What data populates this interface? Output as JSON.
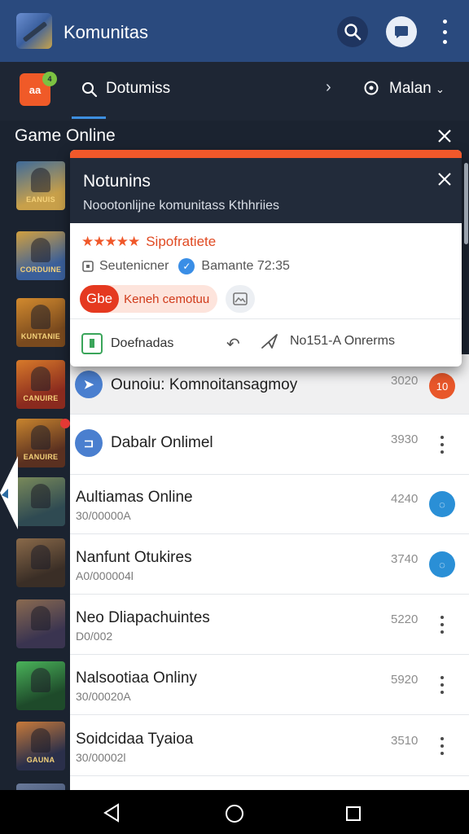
{
  "app_bar": {
    "title": "Komunitas",
    "color": "#2a4a7e"
  },
  "sub_bar": {
    "search_label": "Dotumiss",
    "right_label": "Malan",
    "icon_label": "aa",
    "badge": "4"
  },
  "section": {
    "title": "Game Online"
  },
  "popup": {
    "title": "Notunins",
    "subtitle": "Noootonlijne komunitass Kthhriies",
    "rating_label": "Sipofratiete",
    "stars": "★★★★★",
    "meta_user": "Seutenicner",
    "meta_time": "Bamante 72:35",
    "chip_badge": "Gbe",
    "chip_label": "Keneh cemotuu",
    "footer_left": "Doefnadas",
    "footer_right": "No151-A Onrerms",
    "accent_color": "#f0582a"
  },
  "thumbnails": [
    {
      "caption": "EANUIS",
      "colors": [
        "#c8a04a",
        "#3e6a9a"
      ]
    },
    {
      "caption": "CORDUINE",
      "colors": [
        "#3a5f9a",
        "#d1a040"
      ]
    },
    {
      "caption": "KUNTANIE",
      "colors": [
        "#7a4a1e",
        "#d28a2e"
      ]
    },
    {
      "caption": "CANUIRE",
      "colors": [
        "#8a2a1e",
        "#d77a2a"
      ]
    },
    {
      "caption": "EANUIRE",
      "colors": [
        "#5a3020",
        "#c9852e"
      ]
    },
    {
      "caption": "",
      "colors": [
        "#2f4a52",
        "#7a8a5a"
      ]
    },
    {
      "caption": "",
      "colors": [
        "#3a2e26",
        "#8a6a4a"
      ]
    },
    {
      "caption": "",
      "colors": [
        "#3a3450",
        "#8a6a50"
      ]
    },
    {
      "caption": "",
      "colors": [
        "#1e4a2a",
        "#4ab35a"
      ]
    },
    {
      "caption": "GAUNA",
      "colors": [
        "#2a2f4a",
        "#c87a3a"
      ]
    },
    {
      "caption": "",
      "colors": [
        "#3a4a6a",
        "#6a7a9a"
      ]
    }
  ],
  "list": [
    {
      "title": "Ounoiu: Komnoitansagmoy",
      "sub": "",
      "time": "3020",
      "end_badge": "10",
      "shaded": true
    },
    {
      "title": "Dabalr Onlimel",
      "sub": "",
      "time": "3930",
      "end_badge": "",
      "shaded": false
    },
    {
      "title": "Aultiamas Online",
      "sub": "30/00000A",
      "time": "4240",
      "end_badge": "◌",
      "shaded": false
    },
    {
      "title": "Nanfunt Otukires",
      "sub": "A0/000004l",
      "time": "3740",
      "end_badge": "◌",
      "shaded": false
    },
    {
      "title": "Neo Dliapachuintes",
      "sub": "D0/002",
      "time": "5220",
      "end_badge": "",
      "shaded": false
    },
    {
      "title": "Nalsootiaa Onliny",
      "sub": "30/00020A",
      "time": "5920",
      "end_badge": "",
      "shaded": false
    },
    {
      "title": "Soidcidaa Tyaioa",
      "sub": "30/00002l",
      "time": "3510",
      "end_badge": "",
      "shaded": false
    }
  ]
}
